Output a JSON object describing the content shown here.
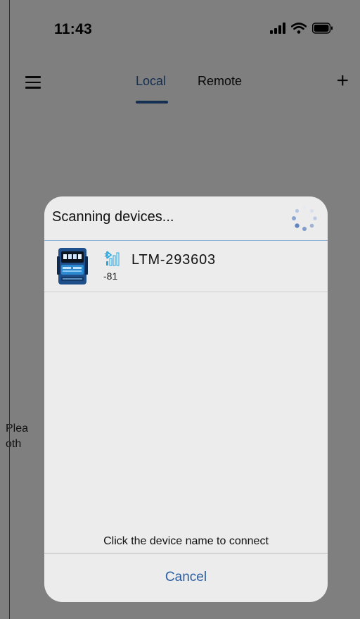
{
  "status_bar": {
    "time": "11:43"
  },
  "nav": {
    "tabs": [
      {
        "label": "Local"
      },
      {
        "label": "Remote"
      }
    ],
    "active_tab": "Local",
    "add_symbol": "+"
  },
  "background": {
    "line1": "Plea",
    "line2": "oth"
  },
  "dialog": {
    "title": "Scanning devices...",
    "devices": [
      {
        "name": "LTM-293603",
        "rssi": "-81"
      }
    ],
    "hint": "Click the device name to connect",
    "cancel_label": "Cancel"
  },
  "colors": {
    "accent": "#2b5ea3",
    "bluetooth": "#29a8e0",
    "dialog_bg": "#ececec"
  }
}
